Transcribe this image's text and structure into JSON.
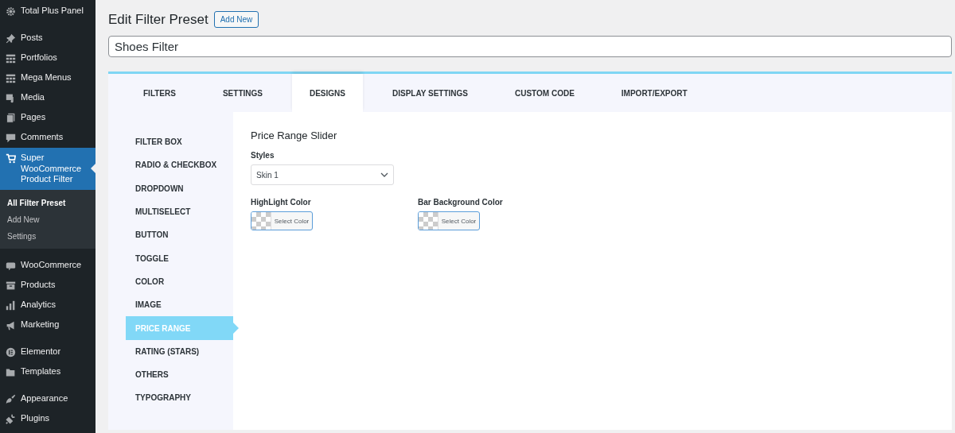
{
  "sidebar": {
    "groups": [
      [
        {
          "label": "Total Plus Panel",
          "kind": "gear",
          "selected": false
        }
      ],
      [
        {
          "label": "Posts",
          "kind": "pin",
          "selected": false
        },
        {
          "label": "Portfolios",
          "kind": "grid",
          "selected": false
        },
        {
          "label": "Mega Menus",
          "kind": "grid",
          "selected": false
        },
        {
          "label": "Media",
          "kind": "media",
          "selected": false
        },
        {
          "label": "Pages",
          "kind": "pages",
          "selected": false
        },
        {
          "label": "Comments",
          "kind": "comment",
          "selected": false
        },
        {
          "label": "Super WooCommerce Product Filter",
          "kind": "cart",
          "selected": true,
          "children": [
            {
              "label": "All Filter Preset",
              "selected": true
            },
            {
              "label": "Add New",
              "selected": false
            },
            {
              "label": "Settings",
              "selected": false
            }
          ]
        }
      ],
      [
        {
          "label": "WooCommerce",
          "kind": "woo",
          "selected": false
        },
        {
          "label": "Products",
          "kind": "box",
          "selected": false
        },
        {
          "label": "Analytics",
          "kind": "chart",
          "selected": false
        },
        {
          "label": "Marketing",
          "kind": "megaphone",
          "selected": false
        }
      ],
      [
        {
          "label": "Elementor",
          "kind": "elementor",
          "selected": false
        },
        {
          "label": "Templates",
          "kind": "folder",
          "selected": false
        }
      ],
      [
        {
          "label": "Appearance",
          "kind": "brush",
          "selected": false
        },
        {
          "label": "Plugins",
          "kind": "plug",
          "selected": false
        }
      ]
    ]
  },
  "page": {
    "title": "Edit Filter Preset",
    "add_button": "Add New",
    "name_value": "Shoes Filter"
  },
  "tabs": [
    {
      "label": "FILTERS",
      "selected": false
    },
    {
      "label": "SETTINGS",
      "selected": false
    },
    {
      "label": "DESIGNS",
      "selected": true
    },
    {
      "label": "DISPLAY SETTINGS",
      "selected": false
    },
    {
      "label": "CUSTOM CODE",
      "selected": false
    },
    {
      "label": "IMPORT/EXPORT",
      "selected": false
    }
  ],
  "design_nav": [
    {
      "label": "FILTER BOX",
      "selected": false
    },
    {
      "label": "RADIO & CHECKBOX",
      "selected": false
    },
    {
      "label": "DROPDOWN",
      "selected": false
    },
    {
      "label": "MULTISELECT",
      "selected": false
    },
    {
      "label": "BUTTON",
      "selected": false
    },
    {
      "label": "TOGGLE",
      "selected": false
    },
    {
      "label": "COLOR",
      "selected": false
    },
    {
      "label": "IMAGE",
      "selected": false
    },
    {
      "label": "PRICE RANGE",
      "selected": true
    },
    {
      "label": "RATING (STARS)",
      "selected": false
    },
    {
      "label": "OTHERS",
      "selected": false
    },
    {
      "label": "TYPOGRAPHY",
      "selected": false
    }
  ],
  "panel": {
    "heading": "Price Range Slider",
    "styles_label": "Styles",
    "styles_value": "Skin 1",
    "colors": [
      {
        "label": "HighLight Color",
        "button": "Select Color"
      },
      {
        "label": "Bar Background Color",
        "button": "Select Color"
      }
    ]
  }
}
